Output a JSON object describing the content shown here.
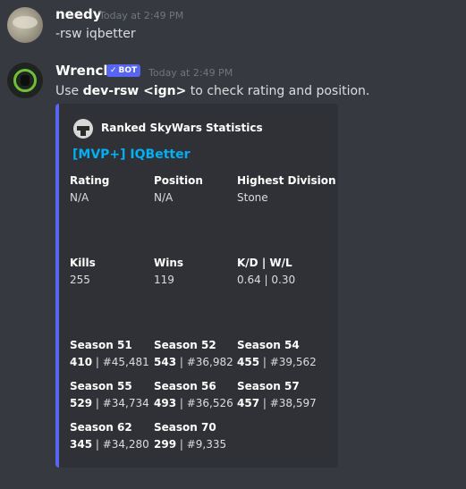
{
  "messages": [
    {
      "author": "needy",
      "time": "Today at 2:49 PM",
      "text": "-rsw iqbetter"
    },
    {
      "author": "Wrench",
      "badge": "BOT",
      "time": "Today at 2:49 PM",
      "text_prefix": "Use ",
      "text_code": "dev-rsw <ign>",
      "text_suffix": " to check rating and position."
    }
  ],
  "embed": {
    "color": "#5865f2",
    "author": "Ranked SkyWars Statistics",
    "title": "[MVP+] IQBetter",
    "fields": [
      {
        "name": "Rating",
        "value": "N/A"
      },
      {
        "name": "Position",
        "value": "N/A"
      },
      {
        "name": "Highest Division",
        "value": "Stone"
      },
      {
        "name": "Kills",
        "value": "255"
      },
      {
        "name": "Wins",
        "value": "119"
      },
      {
        "name": "K/D | W/L",
        "value": "0.64 | 0.30"
      }
    ],
    "seasons": [
      {
        "name": "Season 51",
        "rating": "410",
        "pos": " | #45,481"
      },
      {
        "name": "Season 52",
        "rating": "543",
        "pos": " | #36,982"
      },
      {
        "name": "Season 54",
        "rating": "455",
        "pos": " | #39,562"
      },
      {
        "name": "Season 55",
        "rating": "529",
        "pos": " | #34,734"
      },
      {
        "name": "Season 56",
        "rating": "493",
        "pos": " | #36,526"
      },
      {
        "name": "Season 57",
        "rating": "457",
        "pos": " | #38,597"
      },
      {
        "name": "Season 62",
        "rating": "345",
        "pos": " | #34,280"
      },
      {
        "name": "Season 70",
        "rating": "299",
        "pos": " | #9,335"
      }
    ]
  }
}
